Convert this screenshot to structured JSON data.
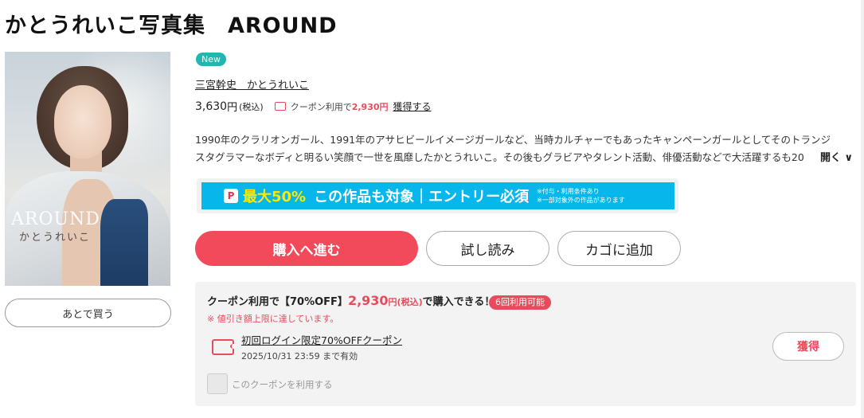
{
  "product": {
    "title": "かとうれいこ写真集　AROUND",
    "badge": "New",
    "authors": "三宮幹史　かとうれいこ",
    "price": "3,630",
    "price_unit": "円",
    "price_tax": "(税込)",
    "coupon_price_label": "クーポン利用で",
    "coupon_price": "2,930円",
    "get_link": "獲得する",
    "description": "1990年のクラリオンガール、1991年のアサヒビールイメージガールなど、当時カルチャーでもあったキャンペーンガールとしてそのトランジスタグラマーなボディと明るい笑顔で一世を風靡したかとうれいこ。その後もグラビアやタレント活動、俳優活動などで大活躍するも20",
    "open_label": "開く",
    "cover_logo": "AROUND",
    "cover_logo_sub": "かとうれいこ",
    "later_button": "あとで買う"
  },
  "banner": {
    "p_icon": "P",
    "percent": "最大50%",
    "target": "この作品も対象｜エントリー必須",
    "note1": "※付与・利用条件あり",
    "note2": "※一部対象外の作品があります"
  },
  "actions": {
    "buy": "購入へ進む",
    "trial": "試し読み",
    "cart": "カゴに追加"
  },
  "coupon": {
    "head_prefix": "クーポン利用で【70%OFF】",
    "head_price": "2,930",
    "head_unit": "円",
    "head_tax": "(税込)",
    "head_suffix": "で購入できる！",
    "uses": "6回利用可能",
    "limit_note": "※ 値引き額上限に達しています。",
    "name": "初回ログイン限定70%OFFクーポン",
    "expiry": "2025/10/31 23:59 まで有効",
    "acquire": "獲得",
    "use_label": "このクーポンを利用する"
  },
  "colors": {
    "accent": "#f24a5a",
    "coupon_red": "#e84b5b",
    "badge_teal": "#1fb8b0",
    "banner_blue": "#07b7ec",
    "banner_yellow": "#ffe800"
  }
}
